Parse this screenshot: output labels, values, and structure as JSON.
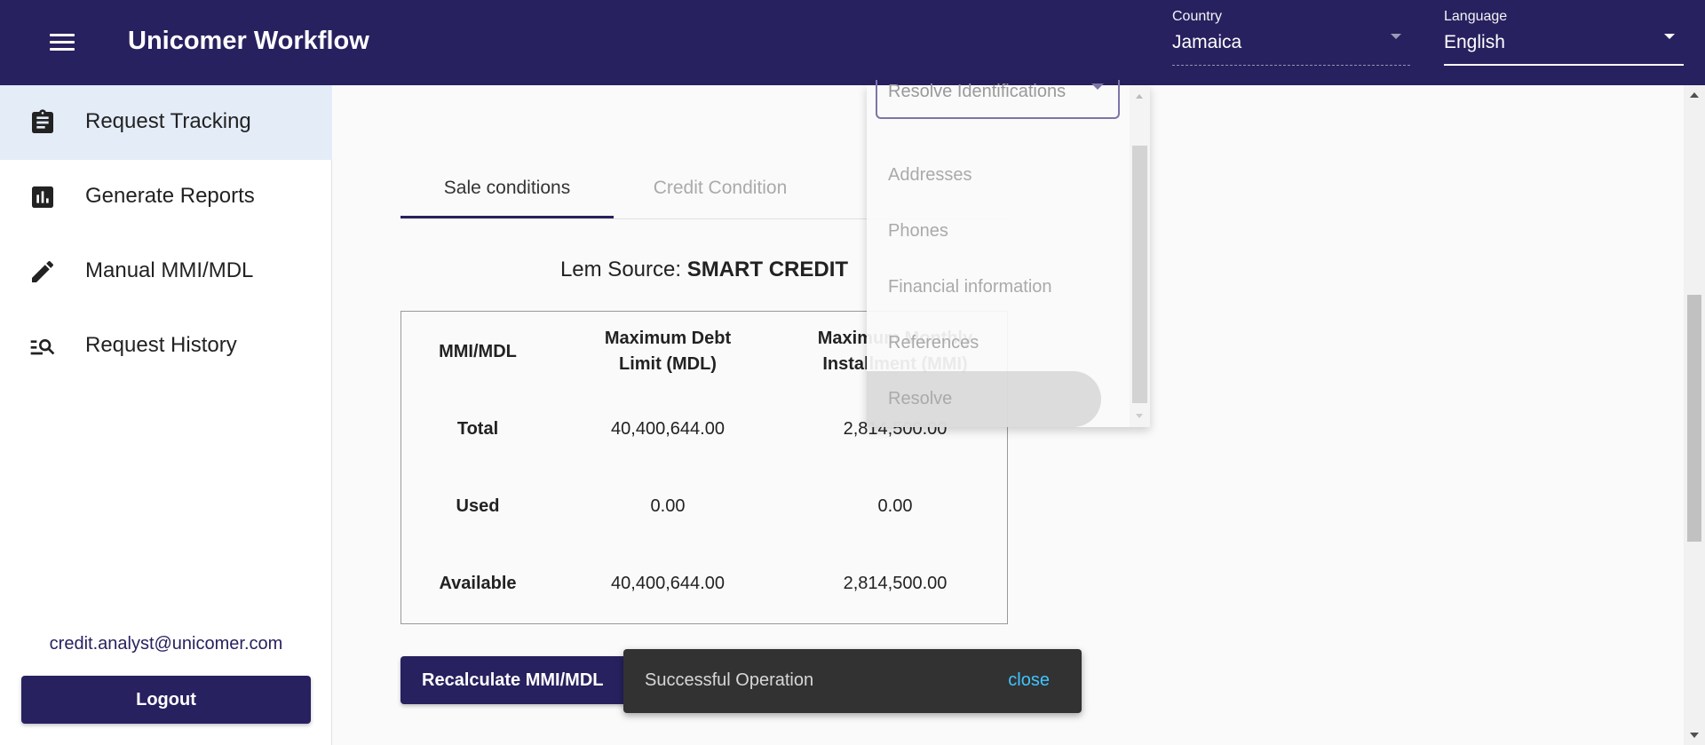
{
  "header": {
    "title": "Unicomer Workflow",
    "country": {
      "label": "Country",
      "value": "Jamaica"
    },
    "language": {
      "label": "Language",
      "value": "English"
    }
  },
  "sidebar": {
    "items": [
      {
        "label": "Request Tracking",
        "icon": "clipboard-icon",
        "active": true
      },
      {
        "label": "Generate Reports",
        "icon": "bar-chart-icon",
        "active": false
      },
      {
        "label": "Manual MMI/MDL",
        "icon": "pencil-icon",
        "active": false
      },
      {
        "label": "Request History",
        "icon": "list-search-icon",
        "active": false
      }
    ],
    "user_email": "credit.analyst@unicomer.com",
    "logout_label": "Logout"
  },
  "main": {
    "tabs": [
      {
        "label": "Sale conditions",
        "active": true
      },
      {
        "label": "Credit Condition",
        "active": false
      }
    ],
    "lem_source_label": "Lem Source:",
    "lem_source_value": "SMART CREDIT",
    "table": {
      "headers": [
        "MMI/MDL",
        "Maximum Debt Limit (MDL)",
        "Maximum Monthly Installment (MMI)"
      ],
      "rows": [
        [
          "Total",
          "40,400,644.00",
          "2,814,500.00"
        ],
        [
          "Used",
          "0.00",
          "0.00"
        ],
        [
          "Available",
          "40,400,644.00",
          "2,814,500.00"
        ]
      ]
    },
    "recalc_label": "Recalculate MMI/MDL"
  },
  "dropdown": {
    "selected": "Resolve Identifications",
    "options": [
      "Addresses",
      "Phones",
      "Financial information",
      "References",
      "Resolve"
    ]
  },
  "snackbar": {
    "message": "Successful Operation",
    "action": "close"
  },
  "colors": {
    "primary": "#27215f",
    "active_nav": "#e4ecf8",
    "snackbar_bg": "#323232",
    "snackbar_action": "#40c4ff"
  }
}
